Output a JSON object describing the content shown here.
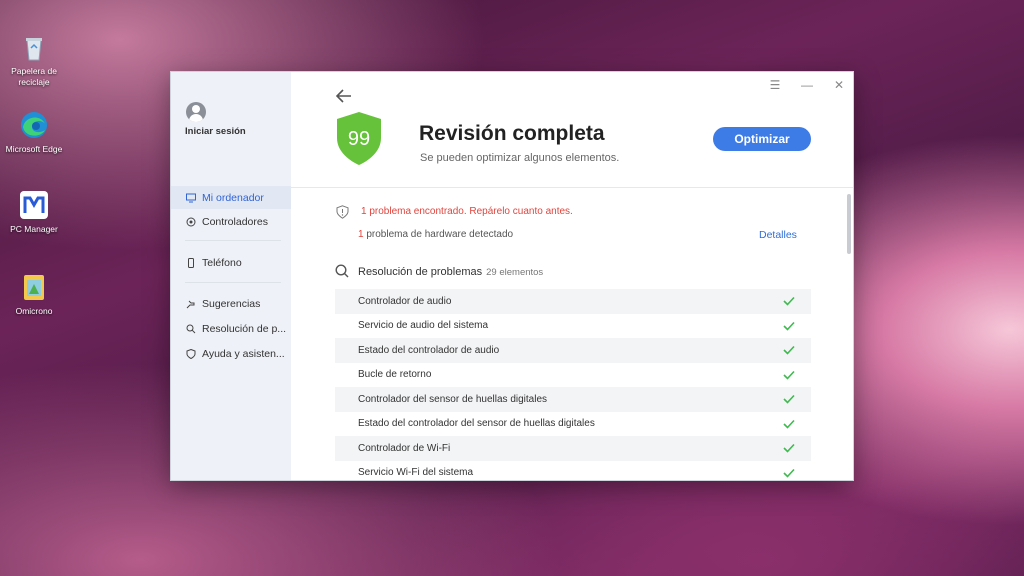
{
  "desktop": {
    "icons": [
      {
        "name": "recycle-bin-icon",
        "label": "Papelera de reciclaje"
      },
      {
        "name": "edge-icon",
        "label": "Microsoft Edge"
      },
      {
        "name": "pc-manager-icon",
        "label": "PC Manager"
      },
      {
        "name": "folder-icon",
        "label": "Omicrono"
      }
    ]
  },
  "sidebar": {
    "signin_label": "Iniciar sesión",
    "items": [
      {
        "label": "Mi ordenador",
        "icon": "monitor-icon",
        "active": true
      },
      {
        "label": "Controladores",
        "icon": "chip-icon"
      },
      {
        "label": "Teléfono",
        "icon": "phone-icon"
      },
      {
        "label": "Sugerencias",
        "icon": "hand-icon"
      },
      {
        "label": "Resolución de p...",
        "icon": "search-icon"
      },
      {
        "label": "Ayuda y asisten...",
        "icon": "shield-icon"
      }
    ]
  },
  "window_controls": {
    "menu": "☰",
    "minimize": "—",
    "close": "✕"
  },
  "header": {
    "score": "99",
    "title": "Revisión completa",
    "subtitle": "Se pueden optimizar algunos elementos.",
    "optimize_label": "Optimizar"
  },
  "alerts": {
    "problem_text": "1 problema encontrado. Repárelo cuanto antes.",
    "hw_count": "1",
    "hw_text": "problema de hardware detectado",
    "details_label": "Detalles"
  },
  "troubleshoot": {
    "title": "Resolución de problemas",
    "count": "29 elementos",
    "items": [
      "Controlador de audio",
      "Servicio de audio del sistema",
      "Estado del controlador de audio",
      "Bucle de retorno",
      "Controlador del sensor de huellas digitales",
      "Estado del controlador del sensor de huellas digitales",
      "Controlador de Wi-Fi",
      "Servicio Wi-Fi del sistema"
    ]
  },
  "colors": {
    "accent": "#3d7be6",
    "error": "#e0453e",
    "check": "#3fb950",
    "shield": "#66c23a"
  }
}
